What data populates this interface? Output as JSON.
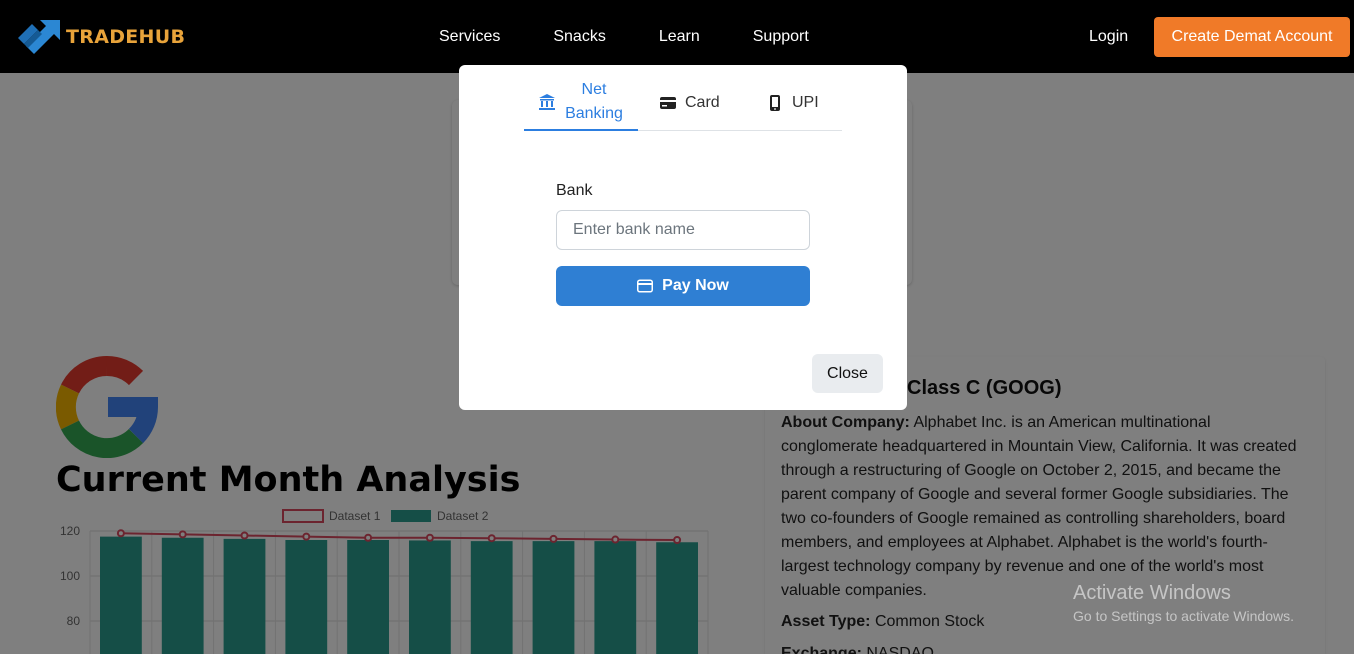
{
  "navbar": {
    "brand": "TRADEHUB",
    "links": [
      "Services",
      "Snacks",
      "Learn",
      "Support"
    ],
    "login": "Login",
    "cta": "Create Demat Account"
  },
  "modal": {
    "tabs": [
      {
        "label": "Net Banking",
        "icon": "bank-icon",
        "active": true
      },
      {
        "label": "Card",
        "icon": "credit-card-icon",
        "active": false
      },
      {
        "label": "UPI",
        "icon": "mobile-phone-icon",
        "active": false
      }
    ],
    "bank_label": "Bank",
    "bank_placeholder": "Enter bank name",
    "pay_label": "Pay Now",
    "close_label": "Close"
  },
  "page": {
    "analysis_title": "Current Month Analysis",
    "info": {
      "title_visible": "Class C (GOOG)",
      "about_label": "About Company:",
      "about_text": "Alphabet Inc. is an American multinational conglomerate headquartered in Mountain View, California. It was created through a restructuring of Google on October 2, 2015, and became the parent company of Google and several former Google subsidiaries. The two co-founders of Google remained as controlling shareholders, board members, and employees at Alphabet. Alphabet is the world's fourth-largest technology company by revenue and one of the world's most valuable companies.",
      "asset_label": "Asset Type:",
      "asset_value": "Common Stock",
      "exchange_label": "Exchange:",
      "exchange_value": "NASDAQ"
    }
  },
  "watermark": {
    "title": "Activate Windows",
    "subtitle": "Go to Settings to activate Windows."
  },
  "colors": {
    "brand": "#e8a33a",
    "cta": "#f07a28",
    "primary": "#2f7fd3",
    "dataset1": "#d9485f",
    "dataset2": "#2a9d8f"
  },
  "chart_data": {
    "type": "bar",
    "legend": [
      "Dataset 1",
      "Dataset 2"
    ],
    "y_ticks": [
      80,
      100,
      120
    ],
    "series": [
      {
        "name": "Dataset 1",
        "type": "line",
        "values": [
          119,
          118.5,
          118,
          117.5,
          117,
          117,
          116.8,
          116.5,
          116.2,
          116
        ]
      },
      {
        "name": "Dataset 2",
        "type": "bar",
        "values": [
          117.5,
          117,
          116.5,
          116,
          116,
          115.8,
          115.5,
          115.5,
          115.5,
          115
        ]
      }
    ],
    "ylim": [
      60,
      125
    ],
    "legend_position": "top"
  }
}
